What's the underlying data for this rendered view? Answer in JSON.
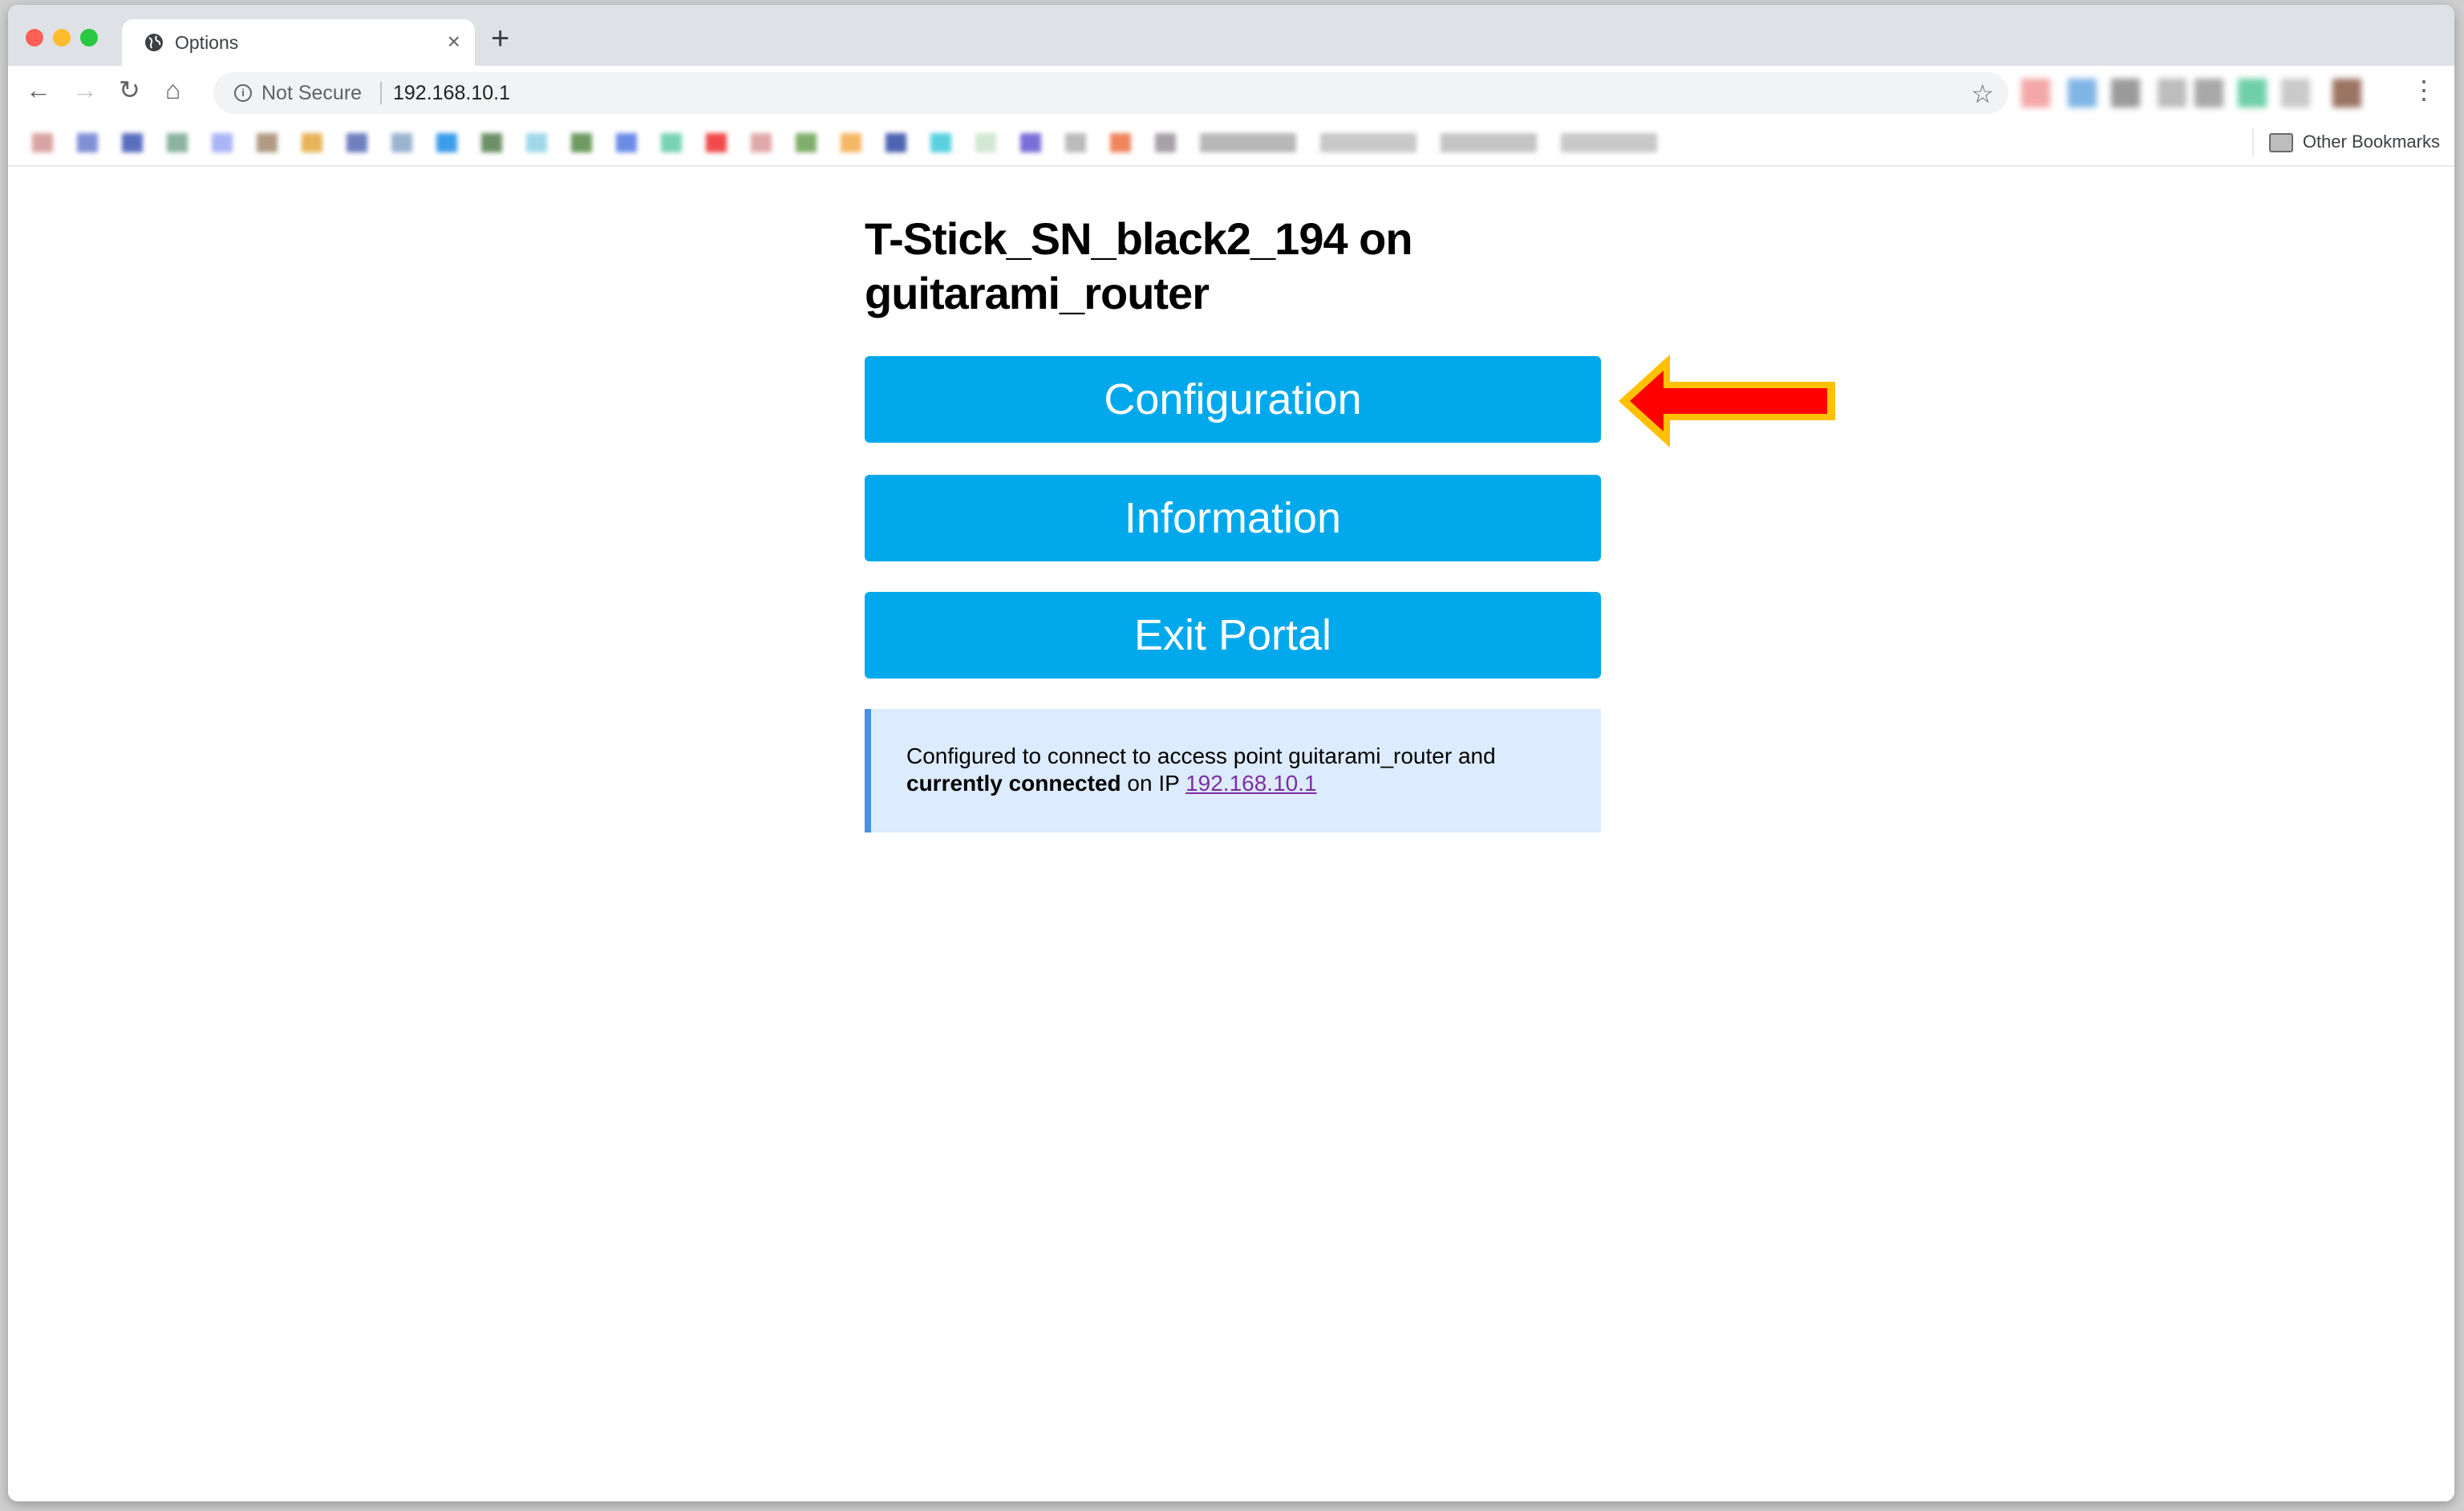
{
  "browser": {
    "tab": {
      "title": "Options",
      "icon": "globe-icon",
      "close_label": "×"
    },
    "new_tab_label": "+",
    "nav": {
      "back": "←",
      "forward": "→",
      "reload": "↻",
      "home": "⌂"
    },
    "omnibox": {
      "security_label": "Not Secure",
      "url": "192.168.10.1",
      "info_glyph": "i"
    },
    "star_glyph": "☆",
    "menu_glyph": "⋮",
    "bookmarks": {
      "other_label": "Other Bookmarks"
    },
    "extension_colors": [
      "#f4a7a7",
      "#7fb5e6",
      "#9a9a9a",
      "#bdbdbd",
      "#a8a8a8",
      "#6fd0a8",
      "#c9c9c9",
      "#9b7463"
    ],
    "bookmark_colors": [
      "#d9a3a3",
      "#7f90d6",
      "#5b6fbf",
      "#8bb39f",
      "#a9b5f5",
      "#b19a84",
      "#e8b45a",
      "#6f7fbf",
      "#9ab3cf",
      "#3a9eea",
      "#6c8f66",
      "#9fd8e8",
      "#6d9a60",
      "#6b8ce6",
      "#78d3b4",
      "#f04a4a",
      "#e0a9a9",
      "#7fae6a",
      "#f4b766",
      "#4d64b2",
      "#58d0e0",
      "#d2e8d2",
      "#7a6fd8",
      "#bbbbbb",
      "#f0855c",
      "#a8a0a8",
      "#b8b8b8",
      "#c8c8c8",
      "#c4c4c4",
      "#c8c8c8"
    ]
  },
  "page": {
    "title": "T-Stick_SN_black2_194 on guitarami_router",
    "buttons": {
      "configuration": "Configuration",
      "information": "Information",
      "exit_portal": "Exit Portal"
    },
    "message": {
      "line1": "Configured to connect to access point guitarami_router and ",
      "bold": "currently connected",
      "middle": " on IP ",
      "link": "192.168.10.1"
    }
  },
  "annotation": {
    "type": "arrow",
    "points_to": "Configuration",
    "fill": "#ff0000",
    "stroke": "#ffc000"
  },
  "colors": {
    "button": "#01a9ec",
    "message_bg": "#dcebfd",
    "message_border": "#4a90e2",
    "link": "#7b2fa8"
  }
}
